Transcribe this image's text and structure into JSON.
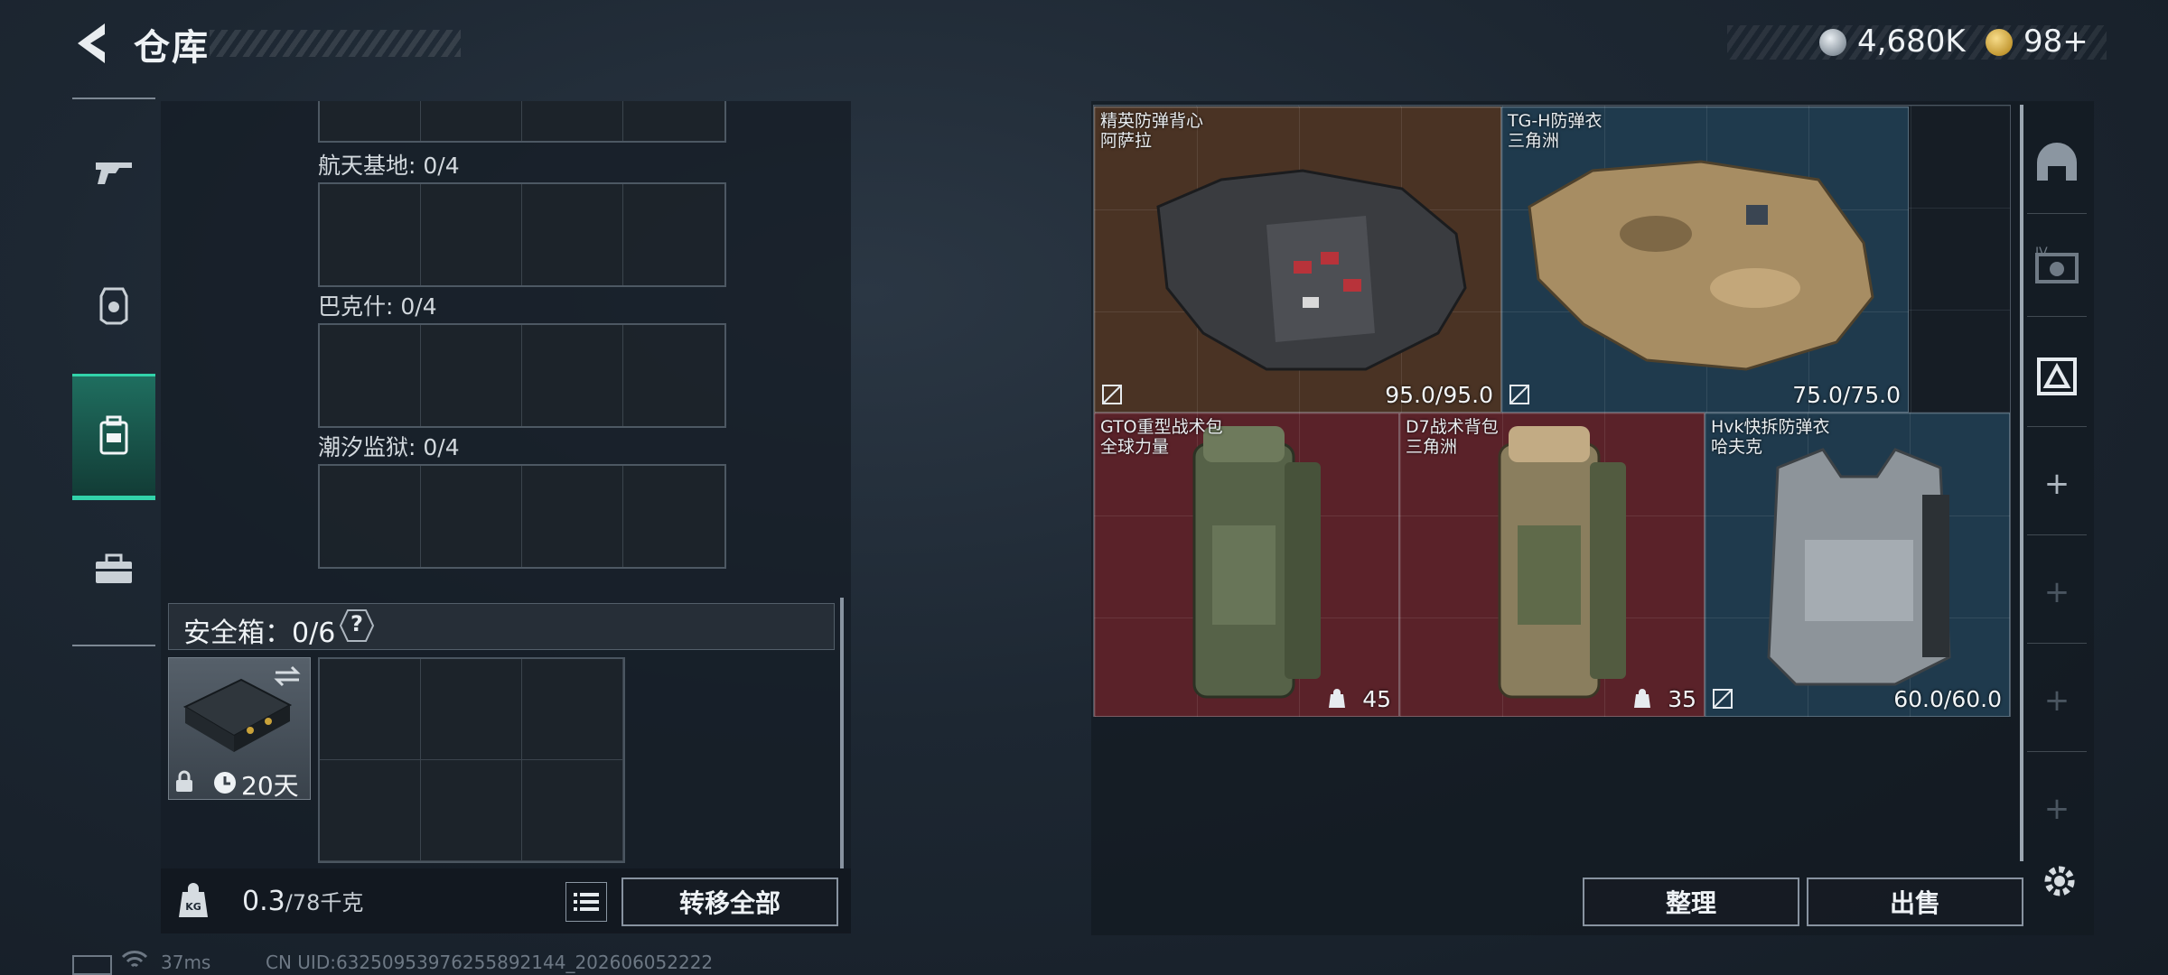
{
  "header": {
    "title": "仓库",
    "currencies": [
      {
        "icon": "silver-coin-icon",
        "value": "4,680K"
      },
      {
        "icon": "gold-coin-icon",
        "value": "98+"
      }
    ]
  },
  "nav": {
    "items": [
      {
        "name": "weapons",
        "icon": "rifle-icon"
      },
      {
        "name": "armor",
        "icon": "helmet-icon"
      },
      {
        "name": "containers",
        "icon": "backpack-icon",
        "active": true
      },
      {
        "name": "supplies",
        "icon": "briefcase-icon"
      }
    ]
  },
  "regions": [
    {
      "label": "航天基地: 0/4"
    },
    {
      "label": "巴克什: 0/4"
    },
    {
      "label": "潮汐监狱: 0/4"
    }
  ],
  "safe_box": {
    "label": "安全箱：0/6",
    "help": "?",
    "duration": "20天"
  },
  "footer_left": {
    "weight_value": "0.3",
    "weight_max": "/78千克",
    "transfer_all": "转移全部"
  },
  "items": [
    {
      "name_line1": "精英防弹背心",
      "name_line2": "阿萨拉",
      "stat": "95.0/95.0",
      "theme": "brown"
    },
    {
      "name_line1": "TG-H防弹衣",
      "name_line2": "三角洲",
      "stat": "75.0/75.0",
      "theme": "blue"
    },
    {
      "name_line1": "GTO重型战术包",
      "name_line2": "全球力量",
      "stat": "45",
      "theme": "red"
    },
    {
      "name_line1": "D7战术背包",
      "name_line2": "三角洲",
      "stat": "35",
      "theme": "red"
    },
    {
      "name_line1": "Hvk快拆防弹衣",
      "name_line2": "哈夫克",
      "stat": "60.0/60.0",
      "theme": "blue"
    }
  ],
  "actions": {
    "sort": "整理",
    "sell": "出售"
  },
  "status_bar": {
    "ping": "37ms",
    "uid": "CN UID:63250953976255892144_202606052222"
  },
  "colors": {
    "accent": "#32d3aa",
    "brown_tile": "#4a3324",
    "blue_tile": "#1f3a4d",
    "red_tile": "#5a2229"
  }
}
